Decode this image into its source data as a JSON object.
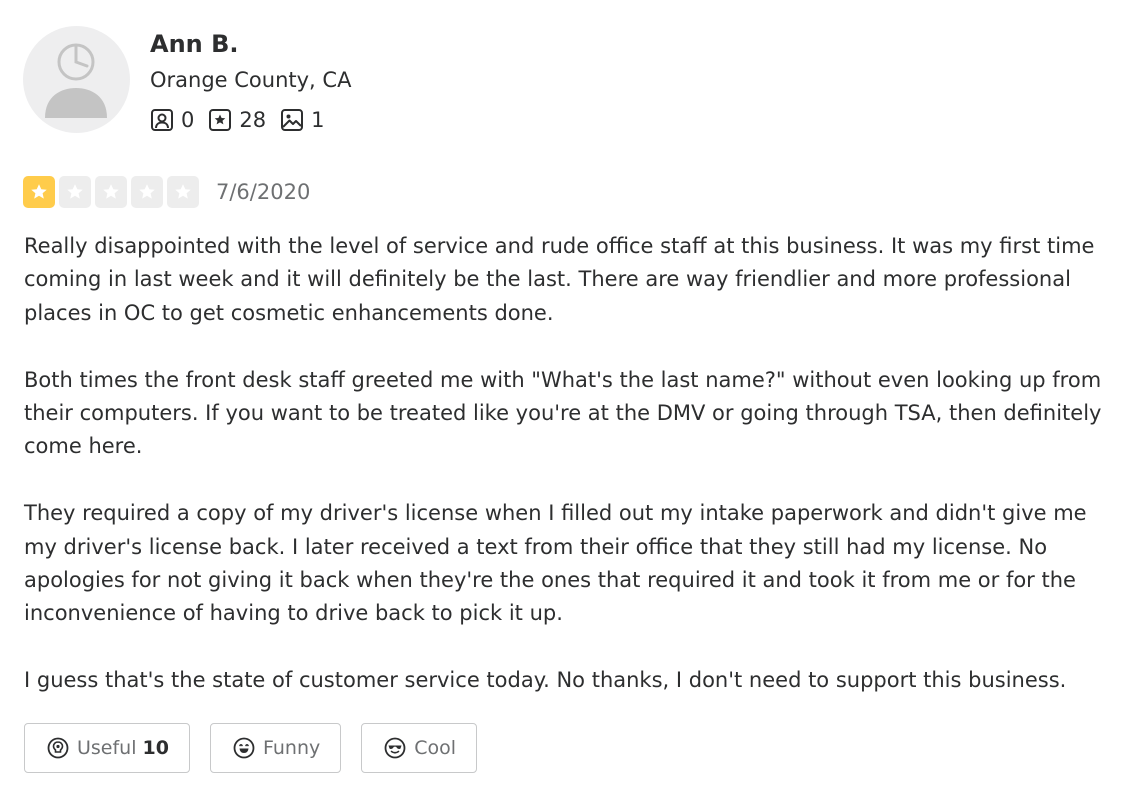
{
  "user": {
    "name": "Ann B.",
    "location": "Orange County, CA",
    "friends_count": "0",
    "reviews_count": "28",
    "photos_count": "1"
  },
  "rating": {
    "stars": 1,
    "max": 5,
    "date": "7/6/2020"
  },
  "review": {
    "paragraphs": [
      "Really disappointed with the level of service and rude office staff at this business. It was my first time coming in last week and it will definitely be the last. There are way friendlier and more professional places in OC to get cosmetic enhancements done.",
      "Both times the front desk staff greeted me with \"What's the last name?\" without even looking up from their computers. If you want to be treated like you're at the DMV or going through TSA, then definitely come here.",
      "They required a copy of my driver's license when I filled out my intake paperwork and didn't give me my driver's license back. I later received a text from their office that they still had my license. No apologies for not giving it back when they're the ones that required it and took it from me or for the inconvenience of having to drive back to pick it up.",
      "I guess that's the state of customer service today. No thanks, I don't need to support this business."
    ]
  },
  "reactions": {
    "useful_label": "Useful",
    "useful_count": "10",
    "funny_label": "Funny",
    "cool_label": "Cool"
  },
  "colors": {
    "star_filled": "#ffcc4b",
    "star_empty": "#ededed",
    "text": "#2d2e2f",
    "muted": "#6e7072"
  }
}
